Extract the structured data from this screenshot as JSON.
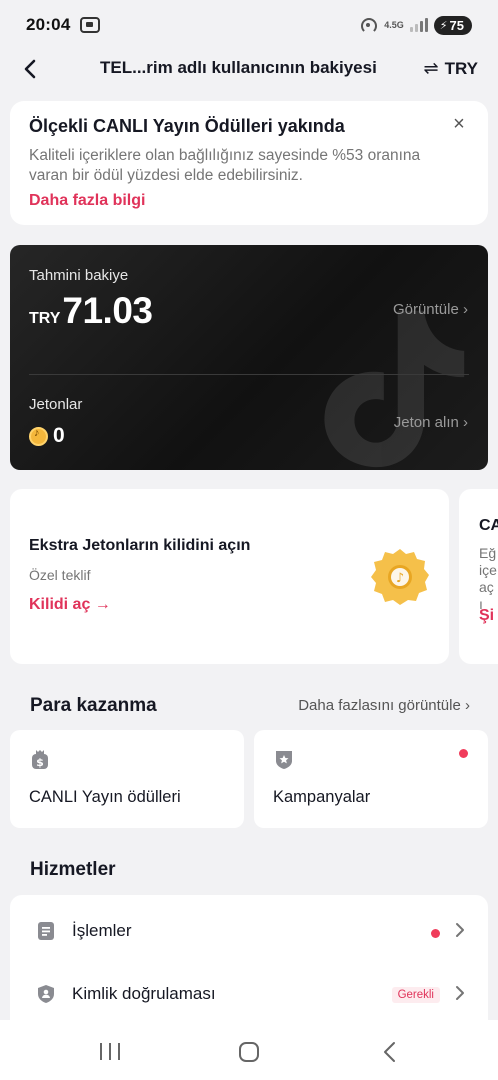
{
  "status_bar": {
    "time": "20:04",
    "network": "4.5G",
    "battery": "75"
  },
  "header": {
    "title": "TEL...rim adlı kullanıcının bakiyesi",
    "currency": "TRY"
  },
  "notice": {
    "title": "Ölçekli CANLI Yayın Ödülleri yakında",
    "description": "Kaliteli içeriklere olan bağlılığınız sayesinde %53 oranına varan bir ödül yüzdesi elde edebilirsiniz.",
    "link": "Daha fazla bilgi"
  },
  "balance": {
    "label": "Tahmini bakiye",
    "currency": "TRY",
    "amount": "71.03",
    "view_link": "Görüntüle ›",
    "coins_label": "Jetonlar",
    "coins_value": "0",
    "buy_link": "Jeton alın ›"
  },
  "promo_cards": [
    {
      "title": "Ekstra Jetonların kilidini açın",
      "subtitle": "Özel teklif",
      "link": "Kilidi aç →"
    },
    {
      "title": "CA",
      "description": "Eğ içe açı",
      "link": "Şi"
    }
  ],
  "earn": {
    "title": "Para kazanma",
    "more_link": "Daha fazlasını görüntüle ›",
    "items": [
      {
        "label": "CANLI Yayın ödülleri",
        "icon": "money-bag-icon"
      },
      {
        "label": "Kampanyalar",
        "icon": "star-shield-icon",
        "has_dot": true
      }
    ]
  },
  "services": {
    "title": "Hizmetler",
    "items": [
      {
        "label": "İşlemler",
        "icon": "document-icon",
        "has_dot": true
      },
      {
        "label": "Kimlik doğrulaması",
        "icon": "shield-icon",
        "badge": "Gerekli"
      }
    ]
  },
  "colors": {
    "accent": "#e0335a",
    "balance_card": "#151515",
    "background": "#f2f2f4"
  }
}
